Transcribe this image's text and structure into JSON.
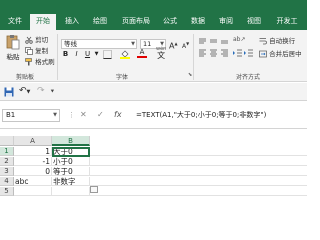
{
  "tabs": [
    "文件",
    "开始",
    "插入",
    "绘图",
    "页面布局",
    "公式",
    "数据",
    "审阅",
    "视图",
    "开发工"
  ],
  "ribbon": {
    "clipboard": {
      "paste": "粘贴",
      "cut": "剪切",
      "copy": "复制",
      "format_painter": "格式刷",
      "label": "剪贴板"
    },
    "font": {
      "name": "等线",
      "size": "11",
      "label": "字体",
      "bold": "B",
      "italic": "I",
      "underline": "U",
      "grow": "A",
      "shrink": "A",
      "wen": "wén"
    },
    "alignment": {
      "wrap": "自动换行",
      "merge": "合并后居中",
      "label": "对齐方式"
    }
  },
  "namebox": "B1",
  "formula": "=TEXT(A1,\"大于0;小于0;等于0;非数字\")",
  "fx": "fx",
  "columns": [
    "A",
    "B"
  ],
  "rows": [
    "1",
    "2",
    "3",
    "4",
    "5"
  ],
  "cells": {
    "a1": "1",
    "a2": "-1",
    "a3": "0",
    "a4": "abc",
    "b1": "大于0",
    "b2": "小于0",
    "b3": "等于0",
    "b4": "非数字"
  },
  "colors": {
    "accent": "#217346"
  }
}
